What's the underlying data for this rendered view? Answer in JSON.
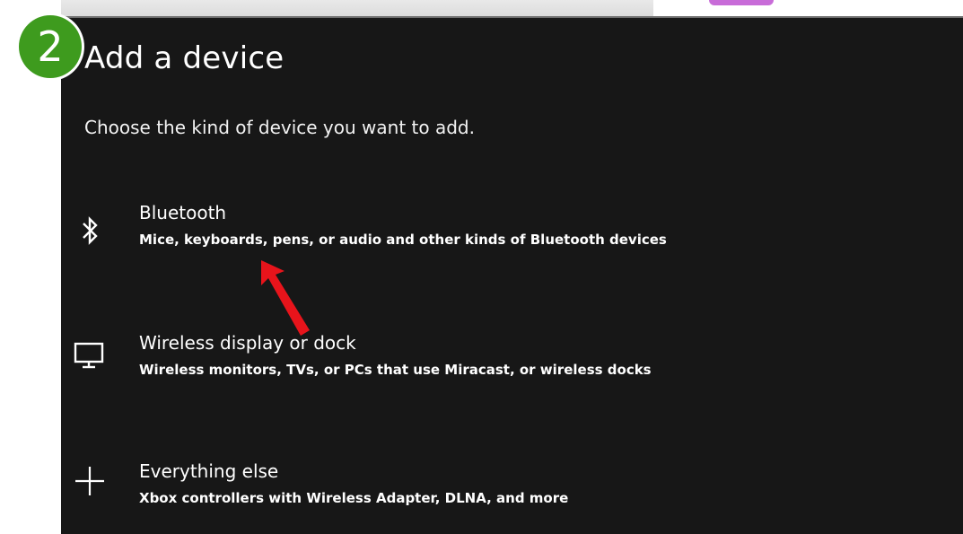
{
  "step_badge": {
    "number": "2",
    "color": "#3e9b1e"
  },
  "dialog": {
    "title": "Add a device",
    "subtitle": "Choose the kind of device you want to add.",
    "background": "#171717"
  },
  "options": [
    {
      "icon": "bluetooth-icon",
      "title": "Bluetooth",
      "description": "Mice, keyboards, pens, or audio and other kinds of Bluetooth devices"
    },
    {
      "icon": "monitor-icon",
      "title": "Wireless display or dock",
      "description": "Wireless monitors, TVs, or PCs that use Miracast, or wireless docks"
    },
    {
      "icon": "plus-icon",
      "title": "Everything else",
      "description": "Xbox controllers with Wireless Adapter, DLNA, and more"
    }
  ],
  "annotation": {
    "icon": "red-arrow-icon",
    "color": "#e8141b"
  }
}
